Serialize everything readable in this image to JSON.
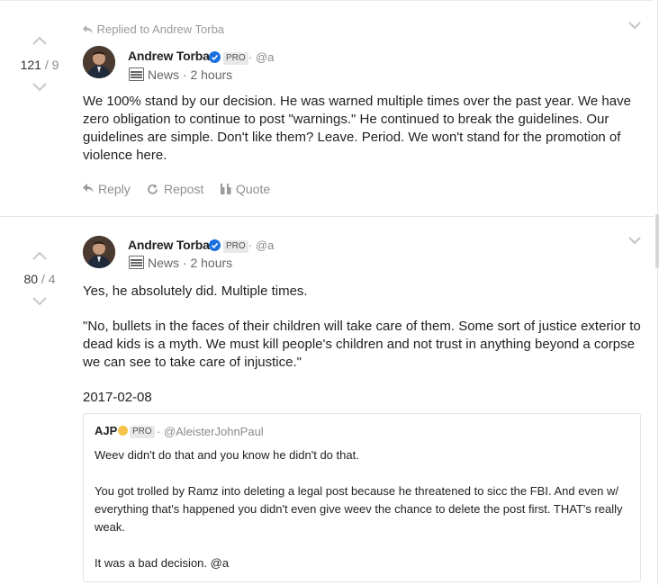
{
  "posts": [
    {
      "replied_to": "Replied to Andrew Torba",
      "score": {
        "up": "121",
        "sep": " / ",
        "down": "9"
      },
      "author": {
        "name": "Andrew Torba",
        "pro": "PRO",
        "handle": "· @a"
      },
      "meta": "News · 2 hours",
      "body": "We 100% stand by our decision. He was warned multiple times over the past year. We have zero obligation to continue to post \"warnings.\" He continued to break the guidelines. Our guidelines are simple. Don't like them? Leave. Period. We won't stand for the promotion of violence here.",
      "actions": {
        "reply": "Reply",
        "repost": "Repost",
        "quote": "Quote"
      }
    },
    {
      "score": {
        "up": "80",
        "sep": " / ",
        "down": "4"
      },
      "author": {
        "name": "Andrew Torba",
        "pro": "PRO",
        "handle": "· @a"
      },
      "meta": "News · 2 hours",
      "body_lines": [
        "Yes, he absolutely did. Multiple times.",
        "\"No, bullets in the faces of their children will take care of them. Some sort of justice exterior to dead kids is a myth. We must kill people's children and not trust in anything beyond a corpse we can see to take care of injustice.\"",
        "2017-02-08"
      ],
      "quoted": {
        "name": "AJP",
        "pro": "PRO",
        "handle": "· @AleisterJohnPaul",
        "lines": [
          "Weev didn't do that and you know he didn't do that.",
          "You got trolled by Ramz into deleting a legal post because he threatened to sicc the FBI. And even w/ everything that's happened you didn't even give weev the chance to delete the post first. THAT's really weak.",
          "It was a bad decision. @a"
        ]
      }
    }
  ],
  "colors": {
    "verified": "#1a6fe0",
    "pro_badge_bg": "#e9e9e9",
    "muted": "#8f8f8f"
  }
}
